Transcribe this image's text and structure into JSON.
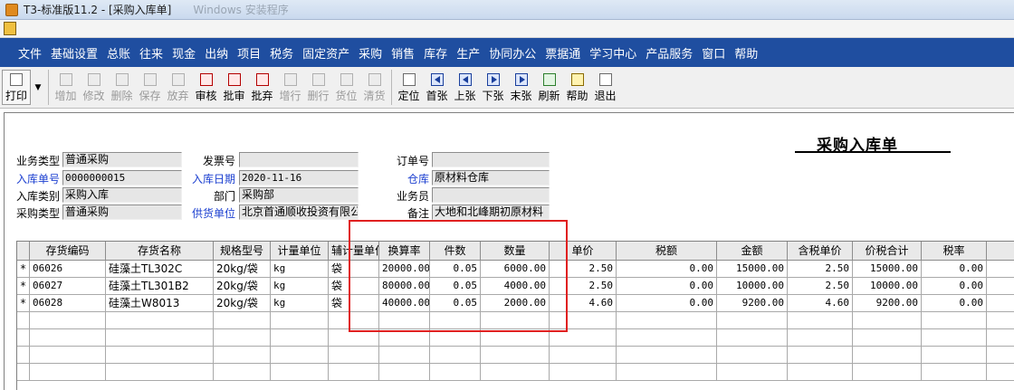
{
  "window": {
    "title": "T3-标准版11.2 - [采购入库单]",
    "ghost_text": "Windows 安装程序"
  },
  "menu": [
    "文件",
    "基础设置",
    "总账",
    "往来",
    "现金",
    "出纳",
    "项目",
    "税务",
    "固定资产",
    "采购",
    "销售",
    "库存",
    "生产",
    "协同办公",
    "票据通",
    "学习中心",
    "产品服务",
    "窗口",
    "帮助"
  ],
  "toolbar": {
    "buttons": [
      {
        "label": "打印",
        "icon": "printer-icon",
        "enabled": true
      },
      {
        "label": "增加",
        "icon": "add-icon",
        "enabled": false
      },
      {
        "label": "修改",
        "icon": "edit-icon",
        "enabled": false
      },
      {
        "label": "删除",
        "icon": "delete-icon",
        "enabled": false
      },
      {
        "label": "保存",
        "icon": "save-icon",
        "enabled": false
      },
      {
        "label": "放弃",
        "icon": "discard-icon",
        "enabled": false
      },
      {
        "label": "审核",
        "icon": "approve-icon",
        "enabled": true
      },
      {
        "label": "批审",
        "icon": "batch-approve-icon",
        "enabled": true
      },
      {
        "label": "批弃",
        "icon": "batch-discard-icon",
        "enabled": true
      },
      {
        "label": "增行",
        "icon": "add-row-icon",
        "enabled": false
      },
      {
        "label": "删行",
        "icon": "delete-row-icon",
        "enabled": false
      },
      {
        "label": "货位",
        "icon": "location-icon",
        "enabled": false
      },
      {
        "label": "清货",
        "icon": "clear-icon",
        "enabled": false
      },
      {
        "label": "定位",
        "icon": "locate-icon",
        "enabled": true
      },
      {
        "label": "首张",
        "icon": "first-icon",
        "enabled": true
      },
      {
        "label": "上张",
        "icon": "prev-icon",
        "enabled": true
      },
      {
        "label": "下张",
        "icon": "next-icon",
        "enabled": true
      },
      {
        "label": "末张",
        "icon": "last-icon",
        "enabled": true
      },
      {
        "label": "刷新",
        "icon": "refresh-icon",
        "enabled": true
      },
      {
        "label": "帮助",
        "icon": "help-icon",
        "enabled": true
      },
      {
        "label": "退出",
        "icon": "exit-icon",
        "enabled": true
      }
    ]
  },
  "document": {
    "title": "采购入库单",
    "fields": {
      "business_type": {
        "label": "业务类型",
        "value": "普通采购"
      },
      "inbound_no": {
        "label": "入库单号",
        "value": "0000000015"
      },
      "inbound_category": {
        "label": "入库类别",
        "value": "采购入库"
      },
      "purchase_type": {
        "label": "采购类型",
        "value": "普通采购"
      },
      "invoice_no": {
        "label": "发票号",
        "value": ""
      },
      "inbound_date": {
        "label": "入库日期",
        "value": "2020-11-16"
      },
      "department": {
        "label": "部门",
        "value": "采购部"
      },
      "supplier": {
        "label": "供货单位",
        "value": "北京首通顺收投资有限公司"
      },
      "order_no": {
        "label": "订单号",
        "value": ""
      },
      "warehouse": {
        "label": "仓库",
        "value": "原材料仓库"
      },
      "salesperson": {
        "label": "业务员",
        "value": ""
      },
      "remark": {
        "label": "备注",
        "value": "大地和北峰期初原材料"
      }
    }
  },
  "grid": {
    "columns": [
      "存货编码",
      "存货名称",
      "规格型号",
      "计量单位",
      "辅计量单位",
      "换算率",
      "件数",
      "数量",
      "单价",
      "税额",
      "金额",
      "含税单价",
      "价税合计",
      "税率"
    ],
    "rows": [
      {
        "marker": "*",
        "code": "06026",
        "name": "硅藻土TL302C",
        "spec": "20kg/袋",
        "unit": "kg",
        "aux_unit": "袋",
        "rate": "20000.00",
        "pieces": "0.05",
        "qty": "6000.00",
        "price": "2.50",
        "tax": "0.00",
        "amount": "15000.00",
        "price_tax": "2.50",
        "total": "15000.00",
        "tax_rate": "0.00"
      },
      {
        "marker": "*",
        "code": "06027",
        "name": "硅藻土TL301B2",
        "spec": "20kg/袋",
        "unit": "kg",
        "aux_unit": "袋",
        "rate": "80000.00",
        "pieces": "0.05",
        "qty": "4000.00",
        "price": "2.50",
        "tax": "0.00",
        "amount": "10000.00",
        "price_tax": "2.50",
        "total": "10000.00",
        "tax_rate": "0.00"
      },
      {
        "marker": "*",
        "code": "06028",
        "name": "硅藻土W8013",
        "spec": "20kg/袋",
        "unit": "kg",
        "aux_unit": "袋",
        "rate": "40000.00",
        "pieces": "0.05",
        "qty": "2000.00",
        "price": "4.60",
        "tax": "0.00",
        "amount": "9200.00",
        "price_tax": "4.60",
        "total": "9200.00",
        "tax_rate": "0.00"
      }
    ]
  },
  "colors": {
    "menu_bg": "#1f4ea0",
    "highlight": "#e02020",
    "blue_label": "#1b3fd0"
  }
}
